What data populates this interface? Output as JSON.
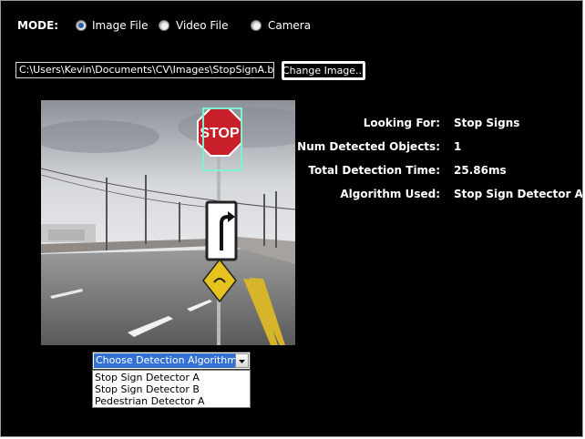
{
  "mode": {
    "label": "MODE:",
    "options": [
      {
        "label": "Image File",
        "selected": true
      },
      {
        "label": "Video File",
        "selected": false
      },
      {
        "label": "Camera",
        "selected": false
      }
    ]
  },
  "file": {
    "path": "C:\\Users\\Kevin\\Documents\\CV\\Images\\StopSignA.bmp",
    "change_button": "Change Image..."
  },
  "info": {
    "looking_for_label": "Looking For:",
    "looking_for_value": "Stop Signs",
    "num_detected_label": "Num Detected Objects:",
    "num_detected_value": "1",
    "time_label": "Total Detection Time:",
    "time_value": "25.86ms",
    "algorithm_label": "Algorithm Used:",
    "algorithm_value": "Stop Sign Detector A"
  },
  "detector_select": {
    "value": "Choose Detection Algorithm",
    "options": [
      "Stop Sign Detector A",
      "Stop Sign Detector B",
      "Pedestrian Detector A"
    ]
  },
  "photo_sign": {
    "stop_text": "STOP"
  },
  "colors": {
    "background": "#000000",
    "selection_blue": "#3370d4",
    "detection_box": "#7ff0d0",
    "stop_red": "#c8202a",
    "warning_yellow": "#e6c21e"
  },
  "icons": {
    "dropdown": "chevron-down-icon"
  }
}
